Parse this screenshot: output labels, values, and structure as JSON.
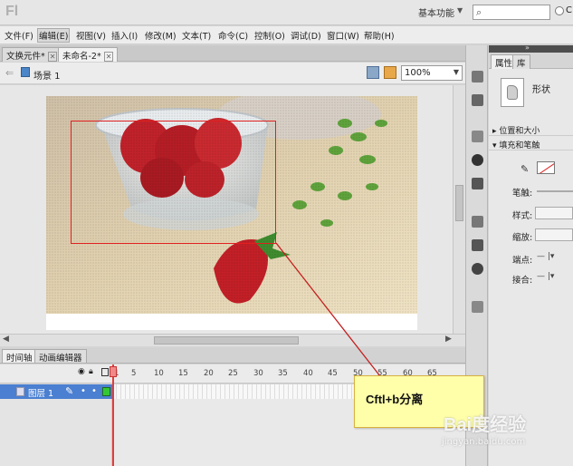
{
  "app": {
    "logo": "Fl",
    "workspace_label": "基本功能",
    "search_placeholder": "",
    "cs_label": "C"
  },
  "menu": [
    "文件(F)",
    "编辑(E)",
    "视图(V)",
    "插入(I)",
    "修改(M)",
    "文本(T)",
    "命令(C)",
    "控制(O)",
    "调试(D)",
    "窗口(W)",
    "帮助(H)"
  ],
  "doc_tabs": [
    {
      "label": "文换元件*",
      "active": false
    },
    {
      "label": "未命名-2*",
      "active": true
    }
  ],
  "editbar": {
    "scene_label": "场景 1",
    "zoom": "100%"
  },
  "timeline": {
    "tabs": [
      "时间轴",
      "动画编辑器"
    ],
    "frame_numbers": [
      "1",
      "5",
      "10",
      "15",
      "20",
      "25",
      "30",
      "35",
      "40",
      "45",
      "50",
      "55",
      "60",
      "65"
    ],
    "layer_name": "图层 1"
  },
  "properties": {
    "tabs": [
      "属性",
      "库"
    ],
    "shape_label": "形状",
    "sections": [
      "位置和大小",
      "填充和笔触"
    ],
    "rows": [
      "笔触:",
      "样式:",
      "缩放:",
      "端点:",
      "接合:"
    ]
  },
  "annotation": {
    "callout_text": "Cftl+b分离",
    "watermark": "Bai度经验",
    "watermark_sub": "jingyan.baidu.com"
  },
  "colors": {
    "selection": "#e02020",
    "layer_highlight": "#4a7fd1",
    "callout_bg": "#ffffaa"
  }
}
